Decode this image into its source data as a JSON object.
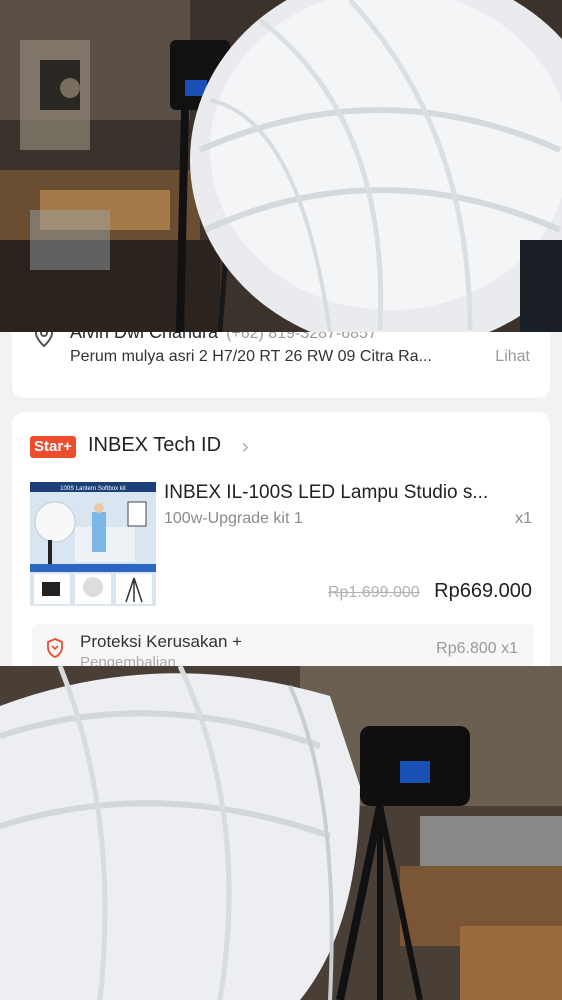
{
  "address": {
    "name": "Alvin Dwi Chandra",
    "phone": "(+62) 819-3287-6857",
    "line": "Perum mulya asri 2 H7/20 RT 26 RW 09 Citra Ra...",
    "view_label": "Lihat"
  },
  "shop": {
    "badge": "Star+",
    "name": "INBEX Tech ID"
  },
  "product": {
    "title": "INBEX IL-100S LED Lampu Studio s...",
    "variant": "100w-Upgrade kit 1",
    "quantity": "x1",
    "price_original": "Rp1.699.000",
    "price_current": "Rp669.000",
    "thumb_caption": "100S Lantern Softbox kit"
  },
  "protection": {
    "label": "Proteksi Kerusakan +",
    "sublabel": "Pengembalian",
    "price": "Rp6.800 x1"
  },
  "colors": {
    "accent": "#ee4d2d",
    "pin": "#555555",
    "shield": "#ee4d2d"
  }
}
